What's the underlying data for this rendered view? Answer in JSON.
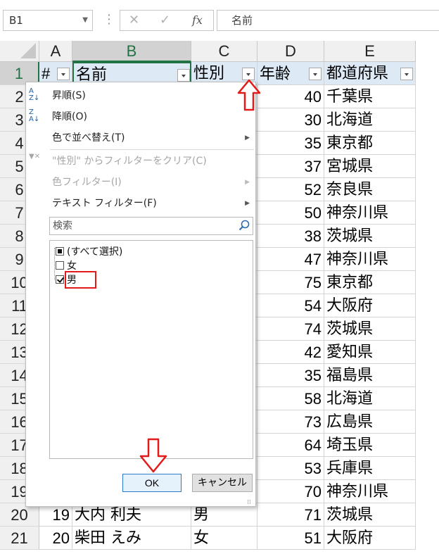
{
  "formula_bar": {
    "name_box": "B1",
    "cancel_symbol": "✕",
    "enter_symbol": "✓",
    "fx_symbol": "fx",
    "content": "名前"
  },
  "columns": [
    "A",
    "B",
    "C",
    "D",
    "E"
  ],
  "selected_column": "B",
  "rows": [
    {
      "row": "1",
      "a": "#",
      "b": "名前",
      "c": "性別",
      "d": "年齢",
      "e": "都道府県"
    },
    {
      "row": "2",
      "a": "",
      "b": "",
      "c": "",
      "d": "40",
      "e": "千葉県"
    },
    {
      "row": "3",
      "a": "",
      "b": "",
      "c": "",
      "d": "30",
      "e": "北海道"
    },
    {
      "row": "4",
      "a": "",
      "b": "",
      "c": "",
      "d": "35",
      "e": "東京都"
    },
    {
      "row": "5",
      "a": "",
      "b": "",
      "c": "",
      "d": "37",
      "e": "宮城県"
    },
    {
      "row": "6",
      "a": "",
      "b": "",
      "c": "",
      "d": "52",
      "e": "奈良県"
    },
    {
      "row": "7",
      "a": "",
      "b": "",
      "c": "",
      "d": "50",
      "e": "神奈川県"
    },
    {
      "row": "8",
      "a": "",
      "b": "",
      "c": "",
      "d": "38",
      "e": "茨城県"
    },
    {
      "row": "9",
      "a": "",
      "b": "",
      "c": "",
      "d": "47",
      "e": "神奈川県"
    },
    {
      "row": "10",
      "a": "",
      "b": "",
      "c": "",
      "d": "75",
      "e": "東京都"
    },
    {
      "row": "11",
      "a": "",
      "b": "",
      "c": "",
      "d": "54",
      "e": "大阪府"
    },
    {
      "row": "12",
      "a": "",
      "b": "",
      "c": "",
      "d": "74",
      "e": "茨城県"
    },
    {
      "row": "13",
      "a": "",
      "b": "",
      "c": "",
      "d": "42",
      "e": "愛知県"
    },
    {
      "row": "14",
      "a": "",
      "b": "",
      "c": "",
      "d": "35",
      "e": "福島県"
    },
    {
      "row": "15",
      "a": "",
      "b": "",
      "c": "",
      "d": "58",
      "e": "北海道"
    },
    {
      "row": "16",
      "a": "",
      "b": "",
      "c": "",
      "d": "73",
      "e": "広島県"
    },
    {
      "row": "17",
      "a": "",
      "b": "",
      "c": "",
      "d": "64",
      "e": "埼玉県"
    },
    {
      "row": "18",
      "a": "",
      "b": "",
      "c": "",
      "d": "53",
      "e": "兵庫県"
    },
    {
      "row": "19",
      "a": "",
      "b": "",
      "c": "",
      "d": "70",
      "e": "神奈川県"
    },
    {
      "row": "20",
      "a": "19",
      "b": "大内 利夫",
      "c": "男",
      "d": "71",
      "e": "茨城県"
    },
    {
      "row": "21",
      "a": "20",
      "b": "柴田 えみ",
      "c": "女",
      "d": "51",
      "e": "大阪府"
    }
  ],
  "filter_menu": {
    "sort_asc": "昇順(S)",
    "sort_desc": "降順(O)",
    "sort_by_color": "色で並べ替え(T)",
    "clear_filter": "\"性別\" からフィルターをクリア(C)",
    "color_filter": "色フィルター(I)",
    "text_filter": "テキスト フィルター(F)",
    "search_placeholder": "検索",
    "items": [
      {
        "label": "(すべて選択)",
        "state": "partial"
      },
      {
        "label": "女",
        "state": "unchecked"
      },
      {
        "label": "男",
        "state": "checked"
      }
    ],
    "ok_label": "OK",
    "cancel_label": "キャンセル"
  },
  "colors": {
    "accent_green": "#217346",
    "highlight_red": "#e31a1a",
    "header_fill": "#dde9f5"
  }
}
